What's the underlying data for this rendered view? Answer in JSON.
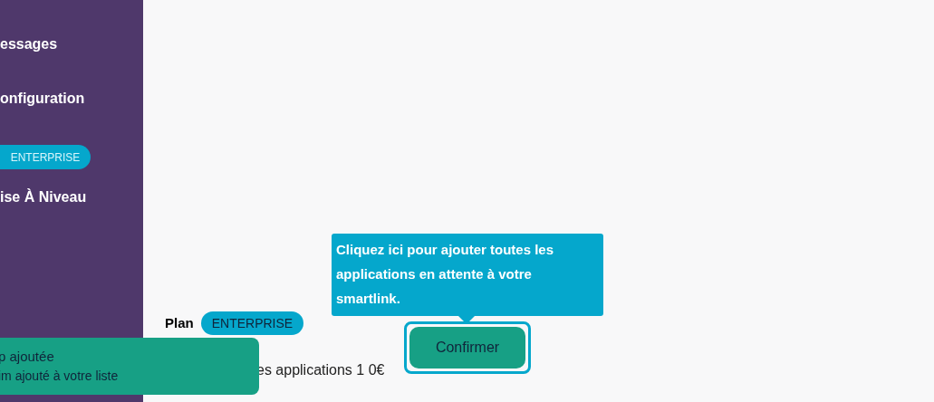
{
  "sidebar": {
    "items": [
      {
        "kind": "link",
        "label": "essages"
      },
      {
        "kind": "link",
        "label": "onfiguration"
      },
      {
        "kind": "badge",
        "label": "ENTERPRISE"
      },
      {
        "kind": "link",
        "label": "ise À Niveau"
      }
    ]
  },
  "tooltip": {
    "text": "Cliquez ici pour ajouter toutes les applications en attente à votre smartlink."
  },
  "plan": {
    "label": "Plan",
    "badge": "ENTERPRISE",
    "summary": "es applications 1 0€"
  },
  "confirm_button": {
    "label": "Confirmer"
  },
  "toast": {
    "title": "p ajoutée",
    "message": "im ajouté à votre liste"
  }
}
